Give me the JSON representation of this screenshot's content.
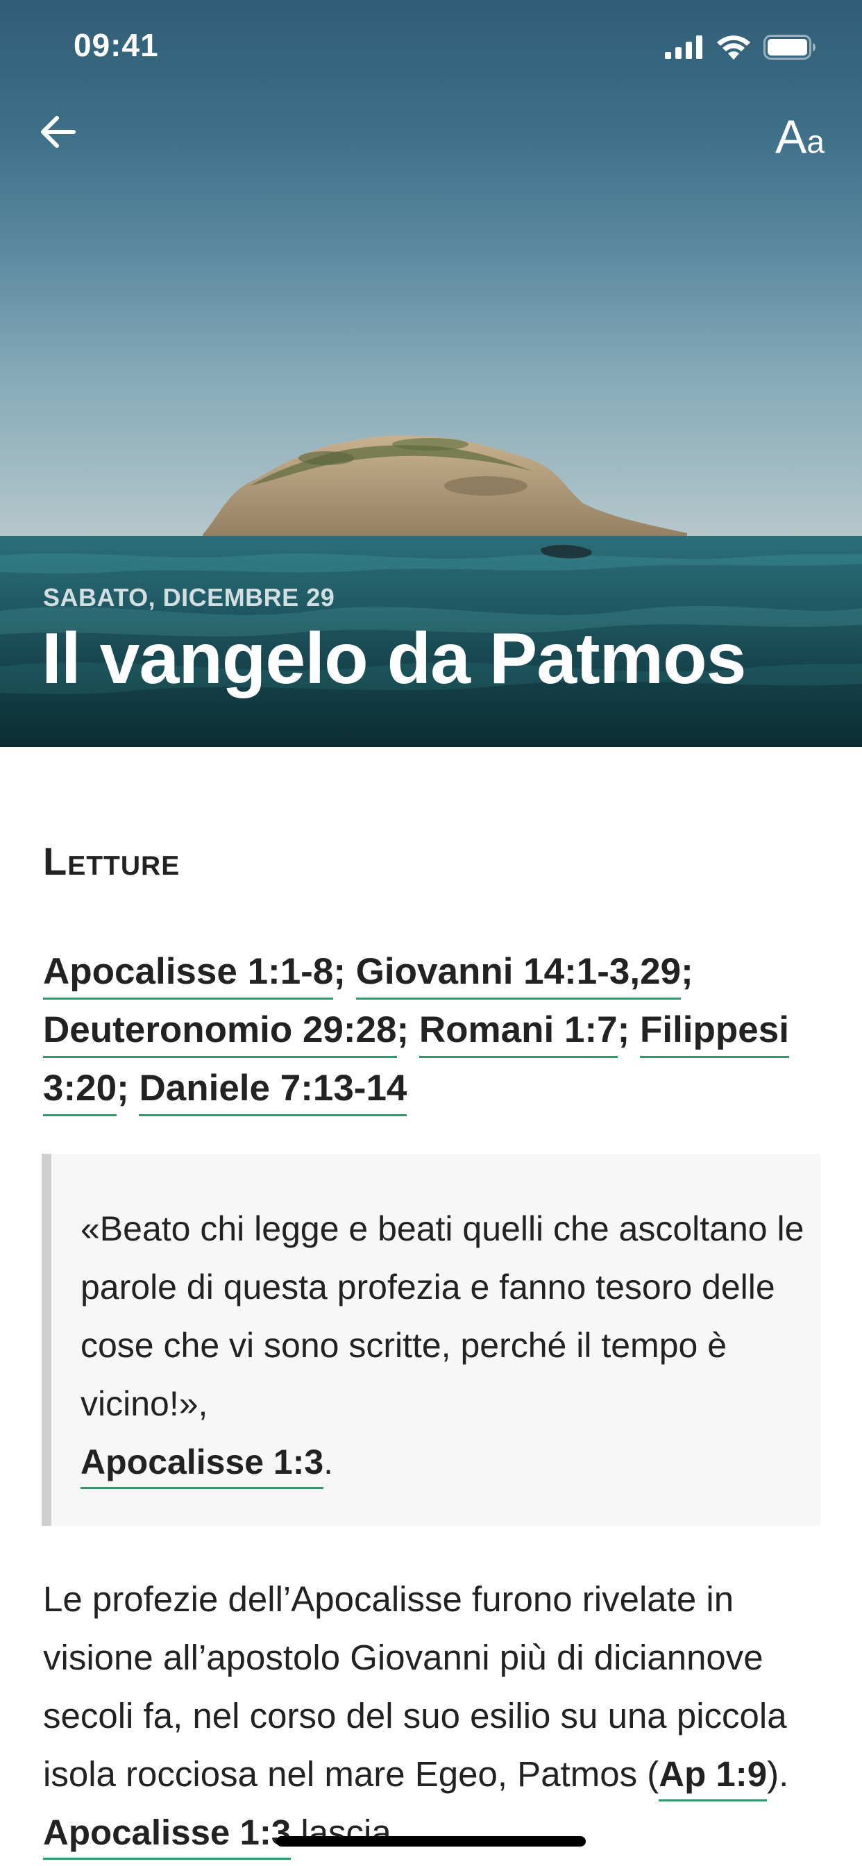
{
  "status_bar": {
    "time": "09:41",
    "icons": [
      "cellular-signal-icon",
      "wifi-icon",
      "battery-icon"
    ]
  },
  "nav": {
    "back_icon": "arrow-left-icon",
    "font_size_big": "A",
    "font_size_small": "a"
  },
  "hero": {
    "date": "SABATO, DICEMBRE 29",
    "title": "Il vangelo da Patmos"
  },
  "section": {
    "heading": "Letture"
  },
  "readings": {
    "refs": [
      "Apocalisse 1:1-8",
      "Giovanni 14:1-3,29",
      "Deuteronomio 29:28",
      "Romani 1:7",
      "Filippesi 3:20",
      "Daniele 7:13-14"
    ],
    "separator": ";"
  },
  "quote": {
    "text": "«Beato chi legge e beati quelli che ascoltano le parole di questa profezia e fanno tesoro delle cose che vi sono scritte, perché il tempo è vicino!»,",
    "ref": "Apocalisse 1:3",
    "end": "."
  },
  "body": {
    "text": "Le profezie dell’Apocalisse furono rivelate in visione all’apostolo Giovanni più di diciannove secoli fa, nel corso del suo esilio su una piccola isola rocciosa nel mare Egeo, Patmos (",
    "ref1": "Ap 1:9",
    "between": "). ",
    "ref2": "Apocalisse 1:3",
    "after": " lascia"
  },
  "colors": {
    "link_underline": "#2e9a6a",
    "quote_border": "#cfcfcf",
    "quote_bg": "#f7f7f7",
    "text": "#222222"
  }
}
